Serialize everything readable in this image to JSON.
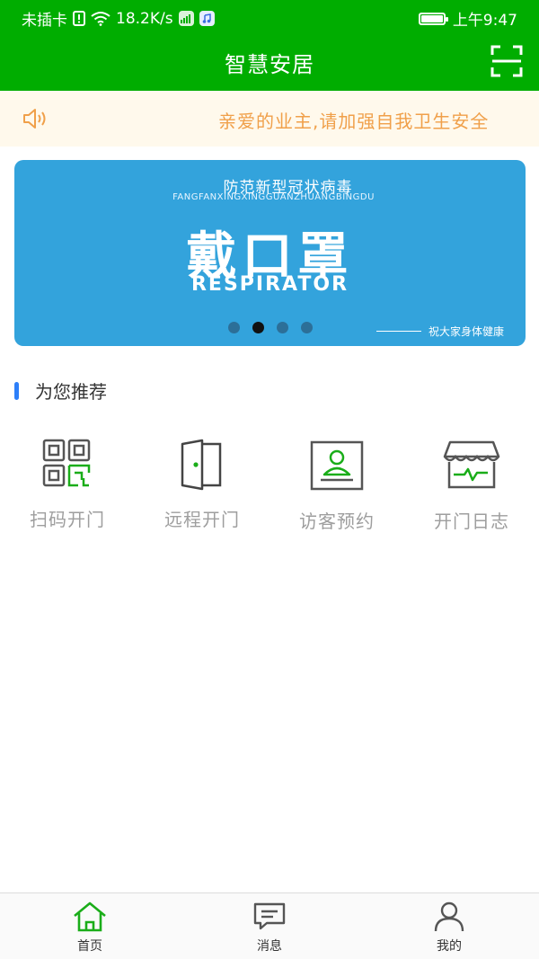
{
  "status_bar": {
    "carrier": "未插卡",
    "net_speed": "18.2K/s",
    "time": "上午9:47"
  },
  "header": {
    "title": "智慧安居",
    "scan_icon": "scan-icon"
  },
  "notice": {
    "icon": "speaker-icon",
    "text": "亲爱的业主,请加强自我卫生安全"
  },
  "banner": {
    "subtitle": "防范新型冠状病毒",
    "pinyin": "FANGFANXINGXINGGUANZHUANGBINGDU",
    "headline": "戴口罩",
    "english": "RESPIRATOR",
    "wish": "祝大家身体健康",
    "page_count": 4,
    "active_page": 2
  },
  "section": {
    "title": "为您推荐"
  },
  "functions": [
    {
      "label": "扫码开门",
      "icon": "qr-code-icon"
    },
    {
      "label": "远程开门",
      "icon": "door-icon"
    },
    {
      "label": "访客预约",
      "icon": "visitor-icon"
    },
    {
      "label": "开门日志",
      "icon": "log-icon"
    }
  ],
  "tabbar": {
    "items": [
      {
        "label": "首页",
        "icon": "home-icon",
        "active": true
      },
      {
        "label": "消息",
        "icon": "message-icon",
        "active": false
      },
      {
        "label": "我的",
        "icon": "profile-icon",
        "active": false
      }
    ]
  },
  "colors": {
    "primary_green": "#00ad00",
    "notice_bg": "#fff9ec",
    "notice_text": "#f0a04a",
    "banner_bg": "#33a3dc",
    "section_accent": "#2d7ff9",
    "icon_green": "#1aad19",
    "label_gray": "#9e9e9e"
  }
}
